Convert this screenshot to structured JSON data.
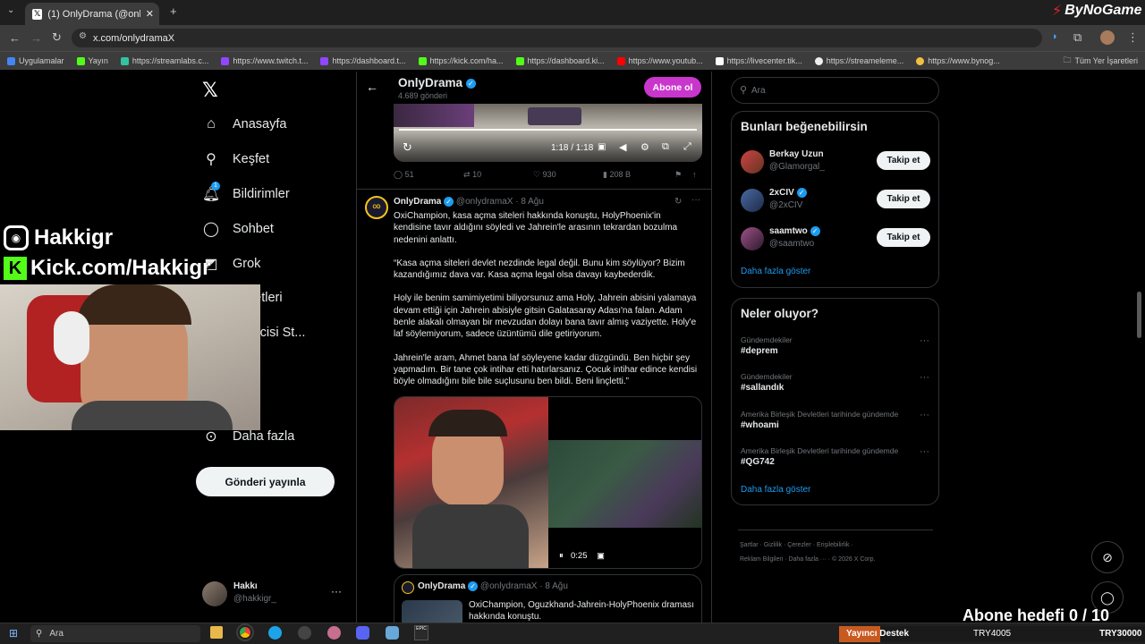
{
  "browser": {
    "tab_title": "(1) OnlyDrama (@onlydramaX)",
    "url": "x.com/onlydramaX",
    "bookmarks": [
      "Uygulamalar",
      "Yayın",
      "https://streamlabs.c...",
      "https://www.twitch.t...",
      "https://dashboard.t...",
      "https://kick.com/ha...",
      "https://dashboard.ki...",
      "https://www.youtub...",
      "https://livecenter.tik...",
      "https://streameleme...",
      "https://www.bynog..."
    ],
    "all_bookmarks": "Tüm Yer İşaretleri"
  },
  "overlay": {
    "brand": "ByNoGame",
    "instagram": "Hakkigr",
    "kick": "Kick.com/Hakkigr",
    "goal": "Abone hedefi 0 / 10"
  },
  "nav": {
    "items": [
      "Anasayfa",
      "Keşfet",
      "Bildirimler",
      "Sohbet",
      "Grok",
      "İşaretleri",
      "Üreticisi St...",
      "ium",
      "Daha fazla"
    ],
    "notif_badge": "1",
    "post_button": "Gönderi yayınla",
    "account_name": "Hakkı",
    "account_handle": "@hakkigr_"
  },
  "profile_header": {
    "name": "OnlyDrama",
    "posts": "4.689 gönderi",
    "subscribe": "Abone ol"
  },
  "video1": {
    "time": "1:18 / 1:18",
    "stats": {
      "replies": "51",
      "reposts": "10",
      "likes": "930",
      "views": "208 B"
    }
  },
  "tweet": {
    "name": "OnlyDrama",
    "handle": "@onlydramaX",
    "date": "8 Ağu",
    "paragraphs": [
      "OxiChampion, kasa açma siteleri hakkında konuştu, HolyPhoenix'in kendisine tavır aldığını söyledi ve Jahrein'le arasının tekrardan bozulma nedenini anlattı.",
      "“Kasa açma siteleri devlet nezdinde legal değil. Bunu kim söylüyor? Bizim kazandığımız dava var. Kasa açma legal olsa davayı kaybederdik.",
      "Holy ile benim samimiyetimi biliyorsunuz ama Holy, Jahrein abisini yalamaya devam ettiği için Jahrein abisiyle gitsin Galatasaray Adası'na falan. Adam benle alakalı olmayan bir mevzudan dolayı bana tavır almış vaziyette. Holy'e laf söylemiyorum, sadece üzüntümü dile getiriyorum.",
      "Jahrein'le aram, Ahmet bana laf söyleyene kadar düzgündü. Ben hiçbir şey yapmadım. Bir tane çok intihar etti hatırlarsanız. Çocuk intihar edince kendisi böyle olmadığını bile bile suçlusunu ben bildi. Beni linçletti.”"
    ],
    "video_time": "0:25"
  },
  "quoted": {
    "name": "OnlyDrama",
    "handle": "@onlydramaX",
    "date": "8 Ağu",
    "text": "OxiChampion, Oguzkhand-Jahrein-HolyPhoenix draması hakkında konuştu."
  },
  "right": {
    "search_placeholder": "Ara",
    "suggest_title": "Bunları beğenebilirsin",
    "suggestions": [
      {
        "name": "Berkay Uzun",
        "handle": "@Glamorgal_",
        "verified": false
      },
      {
        "name": "2xCIV",
        "handle": "@2xCIV",
        "verified": true
      },
      {
        "name": "saamtwo",
        "handle": "@saamtwo",
        "verified": true
      }
    ],
    "follow_label": "Takip et",
    "show_more": "Daha fazla göster",
    "trends_title": "Neler oluyor?",
    "trends": [
      {
        "context": "Gündemdekiler",
        "tag": "#deprem"
      },
      {
        "context": "Gündemdekiler",
        "tag": "#sallandık"
      },
      {
        "context": "Amerika Birleşik Devletleri tarihinde gündemde",
        "tag": "#whoami"
      },
      {
        "context": "Amerika Birleşik Devletleri tarihinde gündemde",
        "tag": "#QG742"
      }
    ],
    "footer1": "Şartlar  ·  Gizlilik  ·  Çerezler  ·  Erişilebilirlik  ·",
    "footer2": "Reklam Bilgileri  ·  Daha fazla ···  ·  © 2026 X Corp."
  },
  "taskbar": {
    "search": "Ara",
    "ticker_label": "Yayıncı Destek",
    "ticker_values": [
      "TRY4005",
      "TRY30000"
    ]
  },
  "colors": {
    "accent": "#1d9bf0",
    "subscribe": "#c936cc",
    "kick": "#53fc18"
  }
}
